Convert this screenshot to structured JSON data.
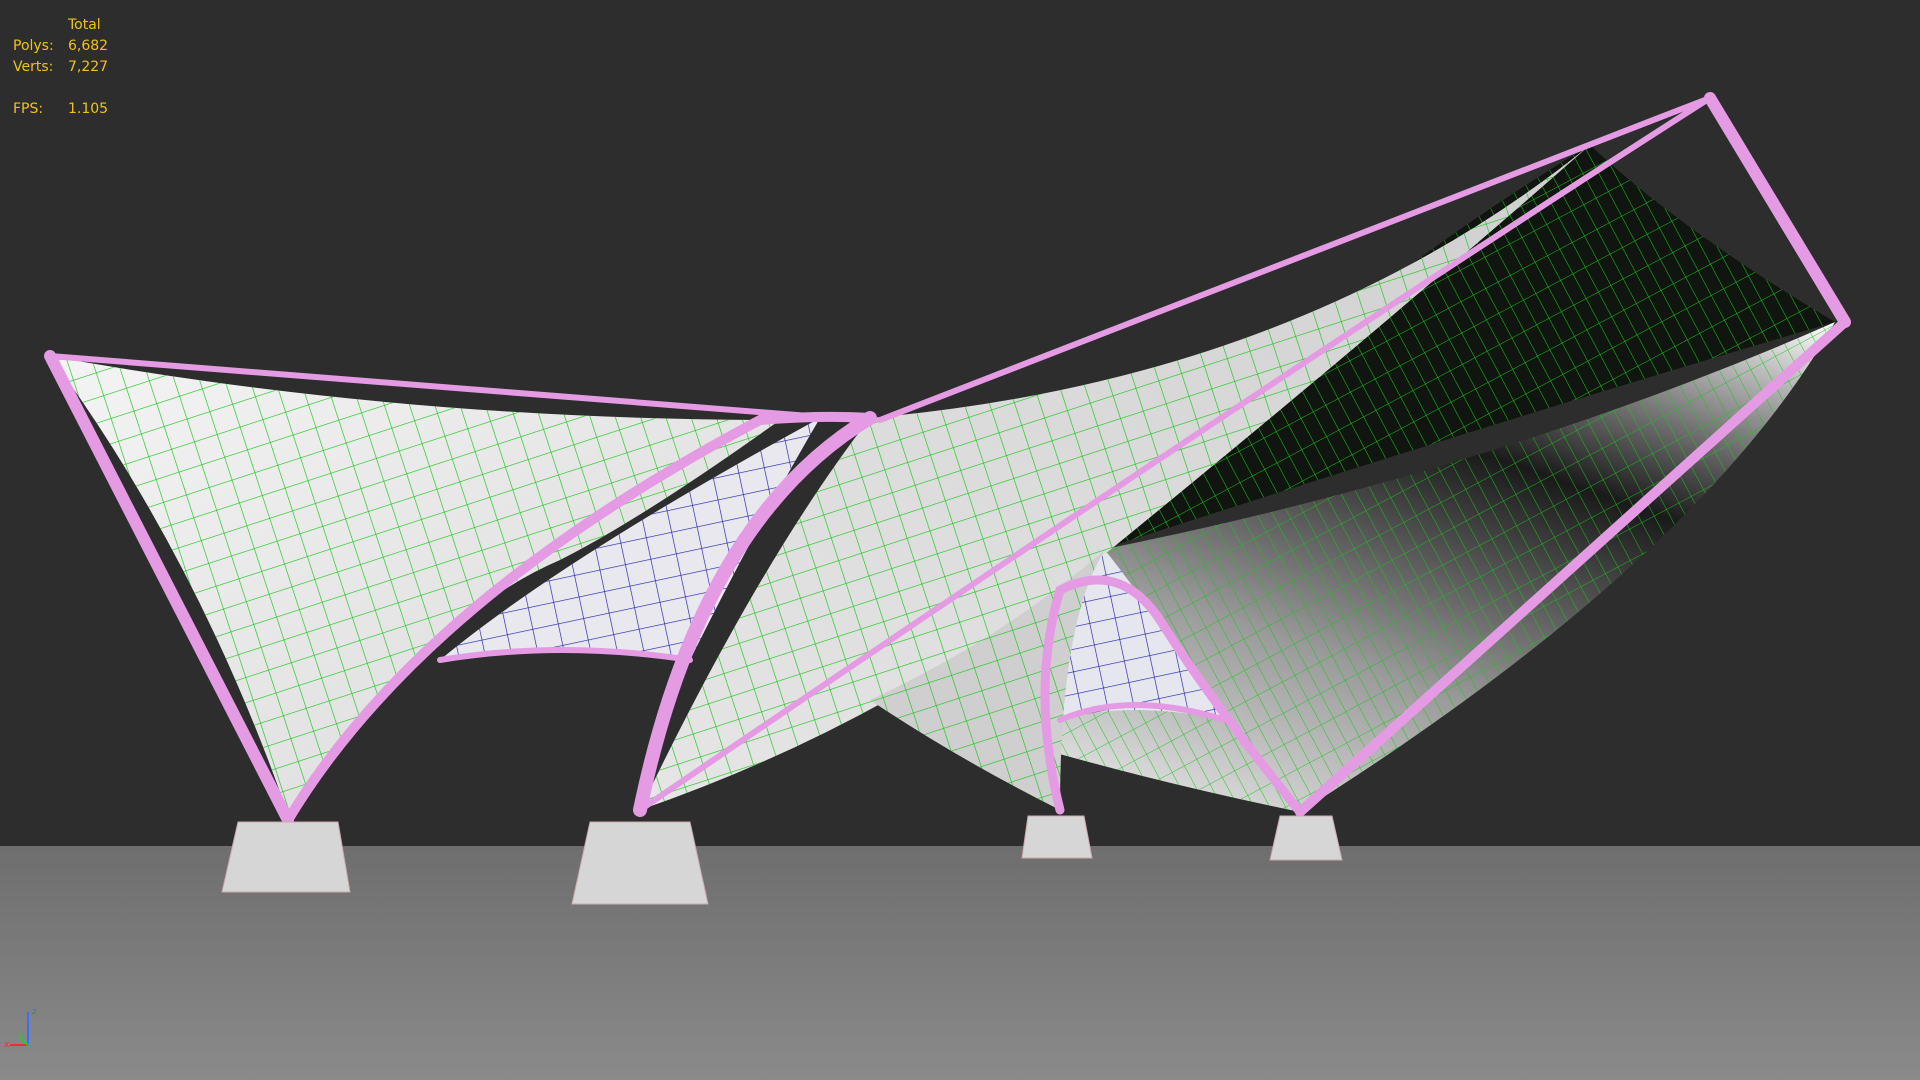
{
  "viewport": {
    "background": "#2d2d2d",
    "ground_color": "#7a7a7a",
    "membrane_color": "#d9d9d9",
    "mesh_green": "#19c419",
    "mesh_blue": "#1e1ea8",
    "frame_color": "#e49be4"
  },
  "stats": {
    "header": "Total",
    "polys_label": "Polys:",
    "polys_value": "6,682",
    "verts_label": "Verts:",
    "verts_value": "7,227",
    "fps_label": "FPS:",
    "fps_value": "1.105",
    "text_color": "#f0c21a"
  },
  "axis_gizmo": {
    "x_label": "x",
    "y_label": "y",
    "z_label": "z"
  }
}
